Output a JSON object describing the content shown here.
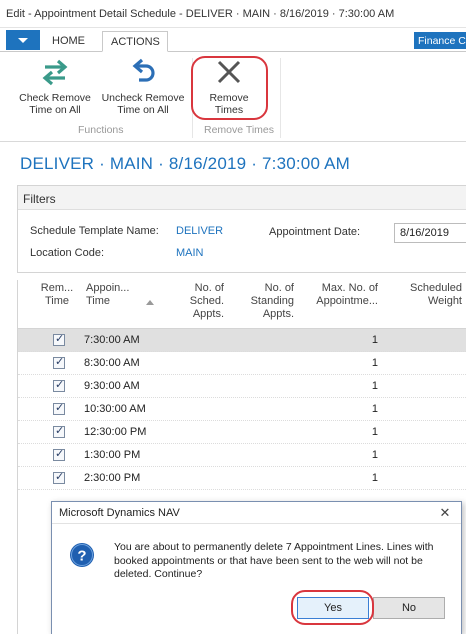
{
  "window": {
    "title": "Edit - Appointment Detail Schedule - DELIVER · MAIN · 8/16/2019 · 7:30:00 AM"
  },
  "tabs": {
    "home": "HOME",
    "actions": "ACTIONS",
    "company": "Finance Co"
  },
  "ribbon": {
    "check_remove": "Check Remove Time on All",
    "uncheck_remove": "Uncheck Remove Time on All",
    "remove_times": "Remove Times",
    "group_functions": "Functions",
    "group_remove_times": "Remove Times"
  },
  "page": {
    "heading": "DELIVER · MAIN · 8/16/2019 · 7:30:00 AM"
  },
  "filters": {
    "header": "Filters",
    "schedule_template_label": "Schedule Template Name:",
    "schedule_template_value": "DELIVER",
    "location_label": "Location Code:",
    "location_value": "MAIN",
    "appointment_date_label": "Appointment Date:",
    "appointment_date_value": "8/16/2019"
  },
  "grid": {
    "columns": {
      "remove_time": "Rem... Time",
      "appointment_time": "Appoin... Time",
      "sched_appts": "No. of Sched. Appts.",
      "standing_appts": "No. of Standing Appts.",
      "max_appts": "Max. No. of Appointme...",
      "scheduled_weight": "Scheduled Weight"
    },
    "rows": [
      {
        "time": "7:30:00 AM",
        "max": "1"
      },
      {
        "time": "8:30:00 AM",
        "max": "1"
      },
      {
        "time": "9:30:00 AM",
        "max": "1"
      },
      {
        "time": "10:30:00 AM",
        "max": "1"
      },
      {
        "time": "12:30:00 PM",
        "max": "1"
      },
      {
        "time": "1:30:00 PM",
        "max": "1"
      },
      {
        "time": "2:30:00 PM",
        "max": "1"
      }
    ]
  },
  "dialog": {
    "title": "Microsoft Dynamics NAV",
    "message": "You are about to permanently delete 7 Appointment Lines.  Lines with booked appointments or that have been sent to the web will not be deleted.  Continue?",
    "yes": "Yes",
    "no": "No",
    "close": "✕"
  },
  "colors": {
    "accent": "#1e73be",
    "highlight": "#d9363e"
  },
  "icons": {
    "check_remove": "swap-arrows-icon",
    "uncheck_remove": "undo-arrow-icon",
    "remove_times": "x-icon",
    "dialog": "question-icon"
  }
}
